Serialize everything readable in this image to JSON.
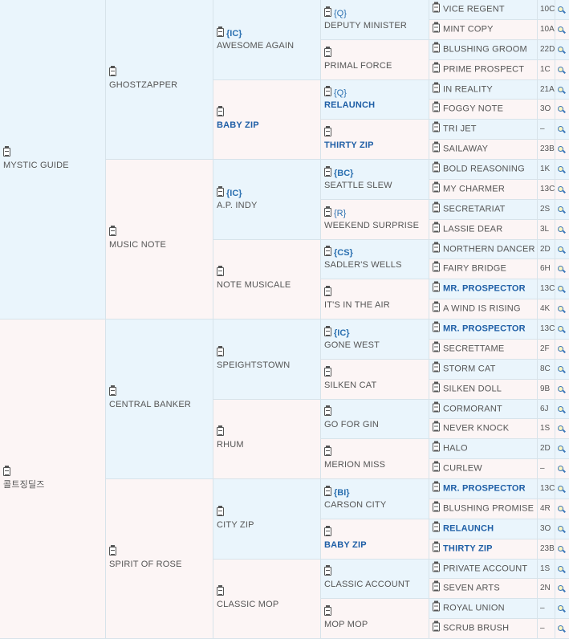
{
  "generations": {
    "g1": [
      {
        "name": "MYSTIC GUIDE"
      },
      {
        "name": "콜트징딜즈"
      }
    ],
    "g2": [
      {
        "name": "GHOSTZAPPER"
      },
      {
        "name": "MUSIC NOTE"
      },
      {
        "name": "CENTRAL BANKER"
      },
      {
        "name": "SPIRIT OF ROSE"
      }
    ],
    "g3": [
      {
        "tag": "{IC}",
        "name": "AWESOME AGAIN",
        "bold": false
      },
      {
        "tag": "",
        "name": "BABY ZIP",
        "bold": true
      },
      {
        "tag": "{IC}",
        "name": "A.P. INDY",
        "bold": false
      },
      {
        "tag": "",
        "name": "NOTE MUSICALE",
        "bold": false
      },
      {
        "tag": "",
        "name": "SPEIGHTSTOWN",
        "bold": false
      },
      {
        "tag": "",
        "name": "RHUM",
        "bold": false
      },
      {
        "tag": "",
        "name": "CITY ZIP",
        "bold": false
      },
      {
        "tag": "",
        "name": "CLASSIC MOP",
        "bold": false
      }
    ],
    "g4": [
      {
        "tag": "{Q}",
        "name": "DEPUTY MINISTER",
        "bold": false
      },
      {
        "tag": "",
        "name": "PRIMAL FORCE",
        "bold": false
      },
      {
        "tag": "{Q}",
        "name": "RELAUNCH",
        "bold": true
      },
      {
        "tag": "",
        "name": "THIRTY ZIP",
        "bold": true
      },
      {
        "tag": "{BC}",
        "name": "SEATTLE SLEW",
        "bold": false
      },
      {
        "tag": "{R}",
        "name": "WEEKEND SURPRISE",
        "bold": false
      },
      {
        "tag": "{CS}",
        "name": "SADLER'S WELLS",
        "bold": false
      },
      {
        "tag": "",
        "name": "IT'S IN THE AIR",
        "bold": false
      },
      {
        "tag": "{IC}",
        "name": "GONE WEST",
        "bold": false
      },
      {
        "tag": "",
        "name": "SILKEN CAT",
        "bold": false
      },
      {
        "tag": "",
        "name": "GO FOR GIN",
        "bold": false
      },
      {
        "tag": "",
        "name": "MERION MISS",
        "bold": false
      },
      {
        "tag": "{BI}",
        "name": "CARSON CITY",
        "bold": false
      },
      {
        "tag": "",
        "name": "BABY ZIP",
        "bold": true
      },
      {
        "tag": "",
        "name": "CLASSIC ACCOUNT",
        "bold": false
      },
      {
        "tag": "",
        "name": "MOP MOP",
        "bold": false
      }
    ],
    "g5": [
      {
        "name": "VICE REGENT",
        "bold": false,
        "code": "10C"
      },
      {
        "name": "MINT COPY",
        "bold": false,
        "code": "10A"
      },
      {
        "name": "BLUSHING GROOM",
        "bold": false,
        "code": "22D"
      },
      {
        "name": "PRIME PROSPECT",
        "bold": false,
        "code": "1C"
      },
      {
        "name": "IN REALITY",
        "bold": false,
        "code": "21A"
      },
      {
        "name": "FOGGY NOTE",
        "bold": false,
        "code": "3O"
      },
      {
        "name": "TRI JET",
        "bold": false,
        "code": "–"
      },
      {
        "name": "SAILAWAY",
        "bold": false,
        "code": "23B"
      },
      {
        "name": "BOLD REASONING",
        "bold": false,
        "code": "1K"
      },
      {
        "name": "MY CHARMER",
        "bold": false,
        "code": "13C"
      },
      {
        "name": "SECRETARIAT",
        "bold": false,
        "code": "2S"
      },
      {
        "name": "LASSIE DEAR",
        "bold": false,
        "code": "3L"
      },
      {
        "name": "NORTHERN DANCER",
        "bold": false,
        "code": "2D"
      },
      {
        "name": "FAIRY BRIDGE",
        "bold": false,
        "code": "6H"
      },
      {
        "name": "MR. PROSPECTOR",
        "bold": true,
        "code": "13C"
      },
      {
        "name": "A WIND IS RISING",
        "bold": false,
        "code": "4K"
      },
      {
        "name": "MR. PROSPECTOR",
        "bold": true,
        "code": "13C"
      },
      {
        "name": "SECRETTAME",
        "bold": false,
        "code": "2F"
      },
      {
        "name": "STORM CAT",
        "bold": false,
        "code": "8C"
      },
      {
        "name": "SILKEN DOLL",
        "bold": false,
        "code": "9B"
      },
      {
        "name": "CORMORANT",
        "bold": false,
        "code": "6J"
      },
      {
        "name": "NEVER KNOCK",
        "bold": false,
        "code": "1S"
      },
      {
        "name": "HALO",
        "bold": false,
        "code": "2D"
      },
      {
        "name": "CURLEW",
        "bold": false,
        "code": "–"
      },
      {
        "name": "MR. PROSPECTOR",
        "bold": true,
        "code": "13C"
      },
      {
        "name": "BLUSHING PROMISE",
        "bold": false,
        "code": "4R"
      },
      {
        "name": "RELAUNCH",
        "bold": true,
        "code": "3O"
      },
      {
        "name": "THIRTY ZIP",
        "bold": true,
        "code": "23B"
      },
      {
        "name": "PRIVATE ACCOUNT",
        "bold": false,
        "code": "1S"
      },
      {
        "name": "SEVEN ARTS",
        "bold": false,
        "code": "2N"
      },
      {
        "name": "ROYAL UNION",
        "bold": false,
        "code": "–"
      },
      {
        "name": "SCRUB BRUSH",
        "bold": false,
        "code": "–"
      }
    ]
  },
  "icons": {
    "document": "clipboard-icon",
    "search": "magnifier-icon"
  },
  "colors": {
    "sire_bg": "#eaf5fc",
    "dam_bg": "#fcf5f5",
    "link": "#1f5fa6",
    "tag": "#2a6fb0"
  }
}
